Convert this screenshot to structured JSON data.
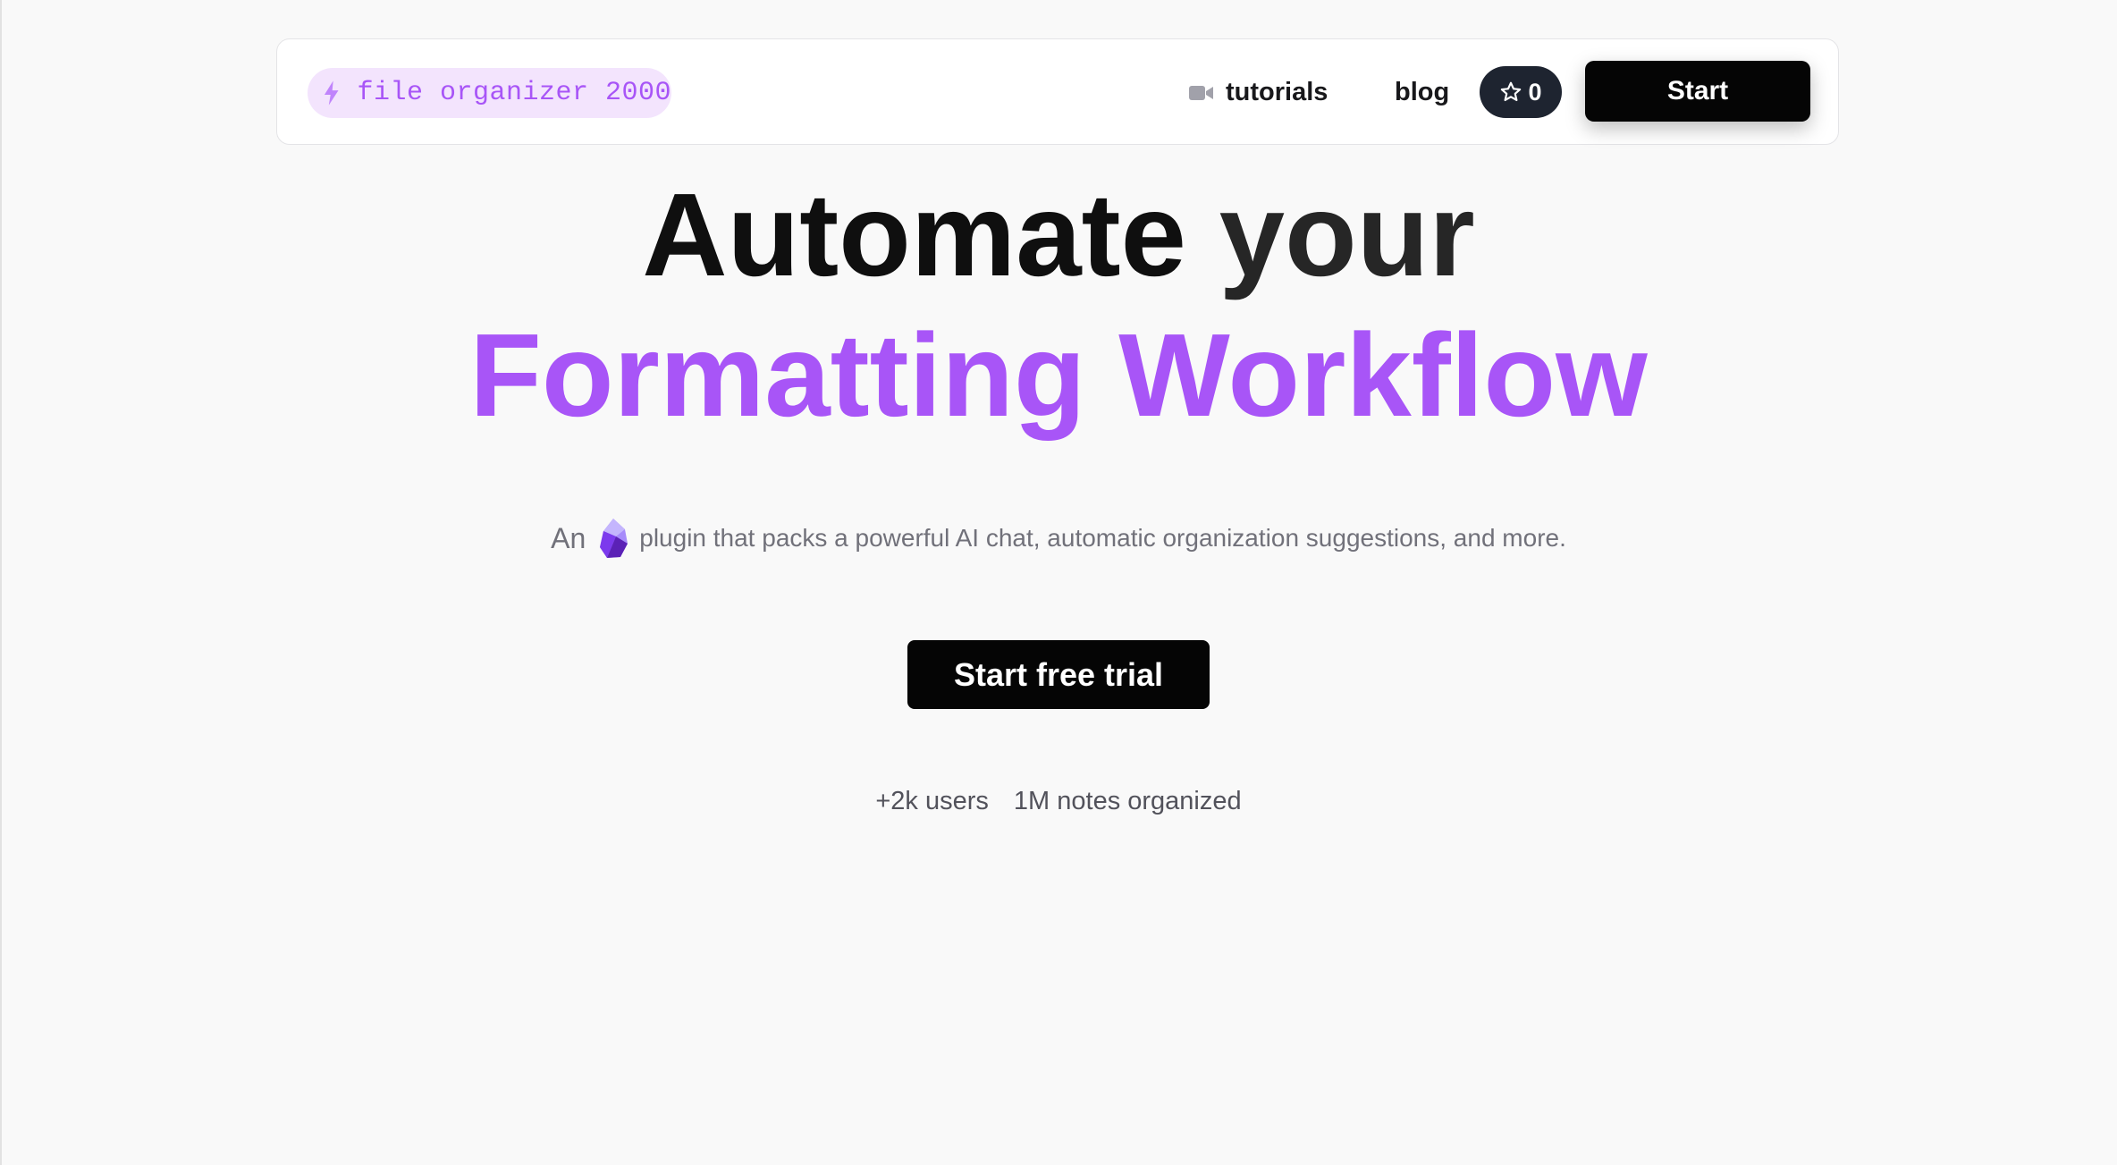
{
  "nav": {
    "brand_label": "file organizer 2000",
    "links": [
      {
        "label": "tutorials",
        "icon": "video-icon"
      },
      {
        "label": "blog"
      }
    ],
    "star_count": "0",
    "start_label": "Start"
  },
  "hero": {
    "line1_a": "Automate ",
    "line1_b": "your",
    "line2": "Formatting Workflow",
    "subtitle_prefix": "An",
    "subtitle_icon": "obsidian-icon",
    "subtitle_rest": "plugin that packs a powerful AI chat, automatic organization suggestions, and more.",
    "cta_label": "Start free trial"
  },
  "stats": {
    "users": "+2k users",
    "notes": "1M notes organized"
  },
  "colors": {
    "accent": "#a855f7",
    "brand_pill_bg": "#f3e4fd",
    "dark_button": "#050505",
    "star_button": "#1e2430",
    "page_bg": "#f9f9f9"
  }
}
